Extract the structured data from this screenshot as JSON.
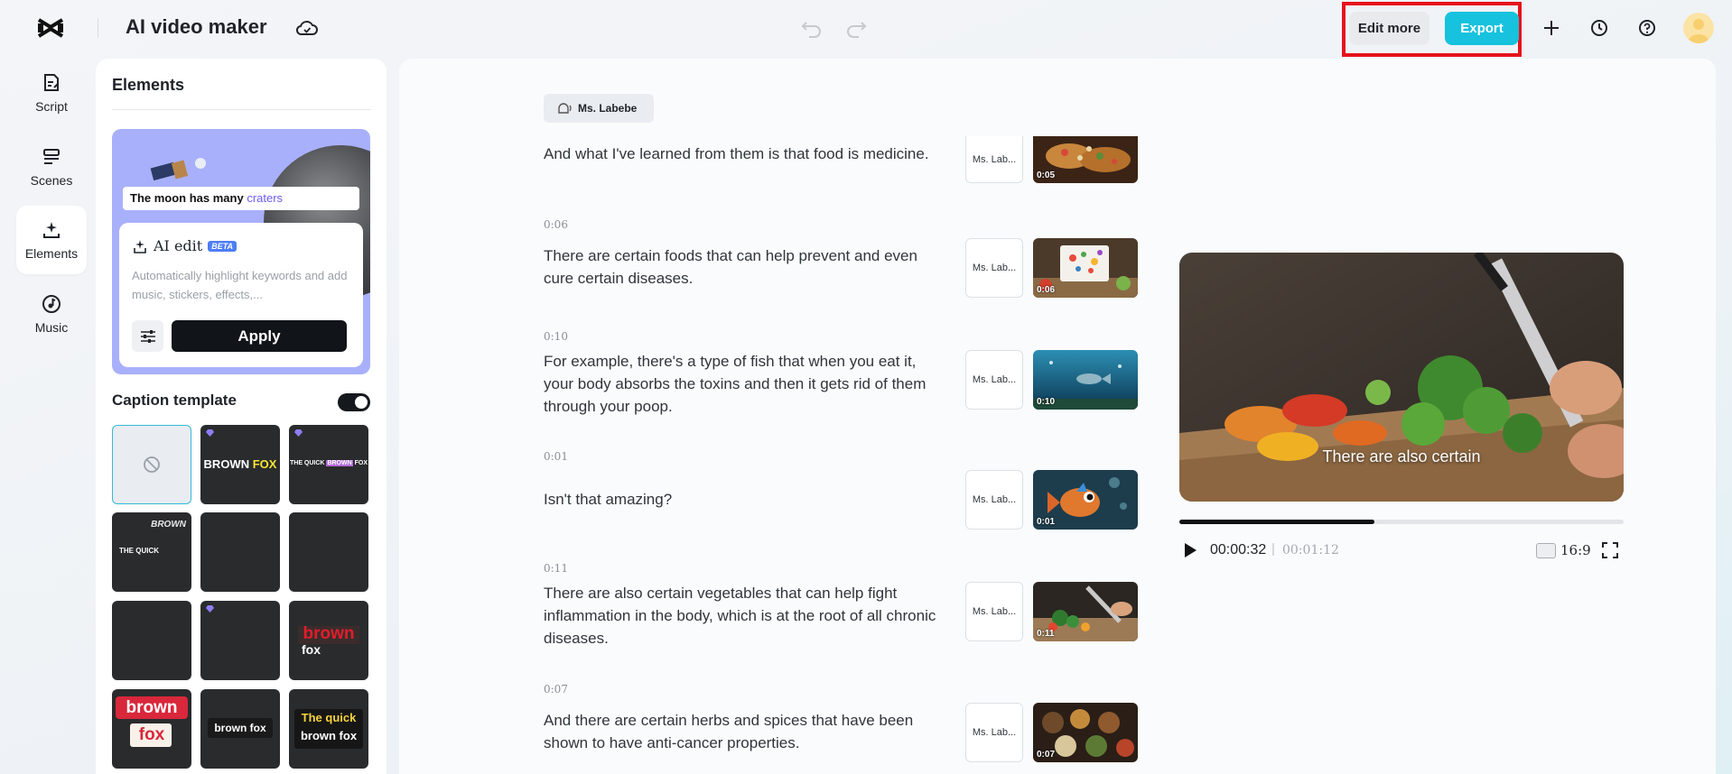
{
  "app": {
    "title": "AI video maker"
  },
  "topbar": {
    "edit_more": "Edit more",
    "export": "Export",
    "accent": "#16c2dd",
    "highlight": "#e5121b"
  },
  "rail": {
    "items": [
      {
        "label": "Script",
        "icon": "script-icon"
      },
      {
        "label": "Scenes",
        "icon": "scenes-icon"
      },
      {
        "label": "Elements",
        "icon": "elements-icon",
        "active": true
      },
      {
        "label": "Music",
        "icon": "music-icon"
      }
    ]
  },
  "panel": {
    "title": "Elements",
    "ai_card": {
      "caption_plain": "The moon has many ",
      "caption_keyword": "craters",
      "edit_title": "AI edit",
      "beta": "BETA",
      "description": "Automatically highlight keywords and add music, stickers, effects,...",
      "apply": "Apply"
    },
    "caption_template": {
      "title": "Caption template",
      "enabled": true
    },
    "templates": [
      {
        "id": "none"
      },
      {
        "text1": "BROWN",
        "text2": "FOX"
      },
      {
        "text1": "THE QUICK",
        "text2": "BROWN",
        "text3": "FOX"
      },
      {
        "text1": "BROWN",
        "text2": "THE QUICK"
      },
      {},
      {},
      {},
      {},
      {
        "text1": "brown",
        "text2": "fox"
      },
      {
        "text1": "brown",
        "text2": "fox"
      },
      {
        "text1": "brown fox"
      },
      {
        "text1": "The quick",
        "text2": "brown fox"
      }
    ]
  },
  "script": {
    "speaker": "Ms. Labebe",
    "voice_short": "Ms. Lab...",
    "segments": [
      {
        "time": "",
        "text": "And what I've learned from them is that food is medicine.",
        "thumb_time": "0:05"
      },
      {
        "time": "0:06",
        "text": "There are certain foods that can help prevent and even cure certain diseases.",
        "thumb_time": "0:06"
      },
      {
        "time": "0:10",
        "text": "For example, there's a type of fish that when you eat it, your body absorbs the toxins and then it gets rid of them through your poop.",
        "thumb_time": "0:10"
      },
      {
        "time": "0:01",
        "text": "Isn't that amazing?",
        "thumb_time": "0:01"
      },
      {
        "time": "0:11",
        "text": "There are also certain vegetables that can help fight inflammation in the body, which is at the root of all chronic diseases.",
        "thumb_time": "0:11"
      },
      {
        "time": "0:07",
        "text": "And there are certain herbs and spices that have been shown to have anti-cancer properties.",
        "thumb_time": "0:07"
      }
    ]
  },
  "preview": {
    "caption": "There are also certain",
    "time_current": "00:00:32",
    "time_separator": "|",
    "time_total": "00:01:12",
    "aspect_ratio": "16:9",
    "progress": 0.44
  }
}
